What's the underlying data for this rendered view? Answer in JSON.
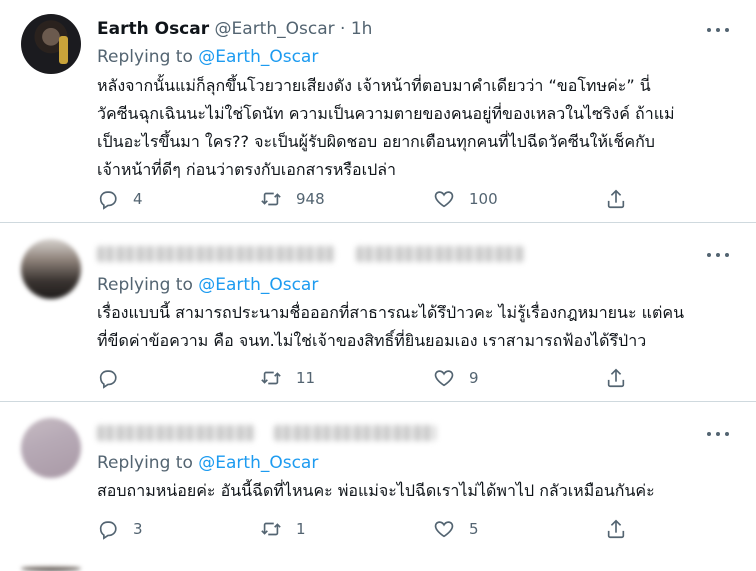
{
  "tweets": [
    {
      "display_name": "Earth Oscar",
      "handle": "@Earth_Oscar",
      "dot": "·",
      "time": "1h",
      "replying_to_label": "Replying to",
      "replying_to_handle": "@Earth_Oscar",
      "body_lines": [
        "หลังจากนั้นแม่ก็ลุกขึ้นโวยวายเสียงดัง เจ้าหน้าที่ตอบมาคำเดียวว่า “ขอโทษค่ะ” นี่",
        "วัคซีนฉุกเฉินนะไม่ใช่โดนัท ความเป็นความตายของคนอยู่ที่ของเหลวในไซริงค์ ถ้าแม่",
        "เป็นอะไรขึ้นมา ใคร?? จะเป็นผู้รับผิดชอบ อยากเตือนทุกคนที่ไปฉีดวัคซีนให้เช็คกับ",
        "เจ้าหน้าที่ดีๆ ก่อนว่าตรงกับเอกสารหรือเปล่า"
      ],
      "replies": "4",
      "retweets": "948",
      "likes": "100"
    },
    {
      "display_name": "",
      "handle": "",
      "dot": "",
      "time": "",
      "replying_to_label": "Replying to",
      "replying_to_handle": "@Earth_Oscar",
      "body_lines": [
        "เรื่องแบบนี้ สามารถประนามชื่อออกที่สาธารณะได้รึป่าวคะ ไม่รู้เรื่องกฎหมายนะ แต่คน",
        "ที่ขีดค่าข้อความ คือ จนท.ไม่ใช่เจ้าของสิทธิ์ที่ยินยอมเอง เราสามารถฟ้องได้รึป่าว"
      ],
      "replies": "",
      "retweets": "11",
      "likes": "9"
    },
    {
      "display_name": "",
      "handle": "",
      "dot": "",
      "time": "",
      "replying_to_label": "Replying to",
      "replying_to_handle": "@Earth_Oscar",
      "body_lines": [
        "สอบถามหน่อยค่ะ อันนี้ฉีดที่ไหนคะ พ่อแม่จะไปฉีดเราไม่ได้พาไป กลัวเหมือนกันค่ะ"
      ],
      "replies": "3",
      "retweets": "1",
      "likes": "5"
    }
  ],
  "icons": {
    "reply": "reply-icon",
    "retweet": "retweet-icon",
    "like": "heart-icon",
    "share": "share-icon",
    "more": "more-icon"
  },
  "colors": {
    "text": "#0f1419",
    "secondary": "#536471",
    "link": "#1d9bf0",
    "divider": "#cfd9de"
  }
}
